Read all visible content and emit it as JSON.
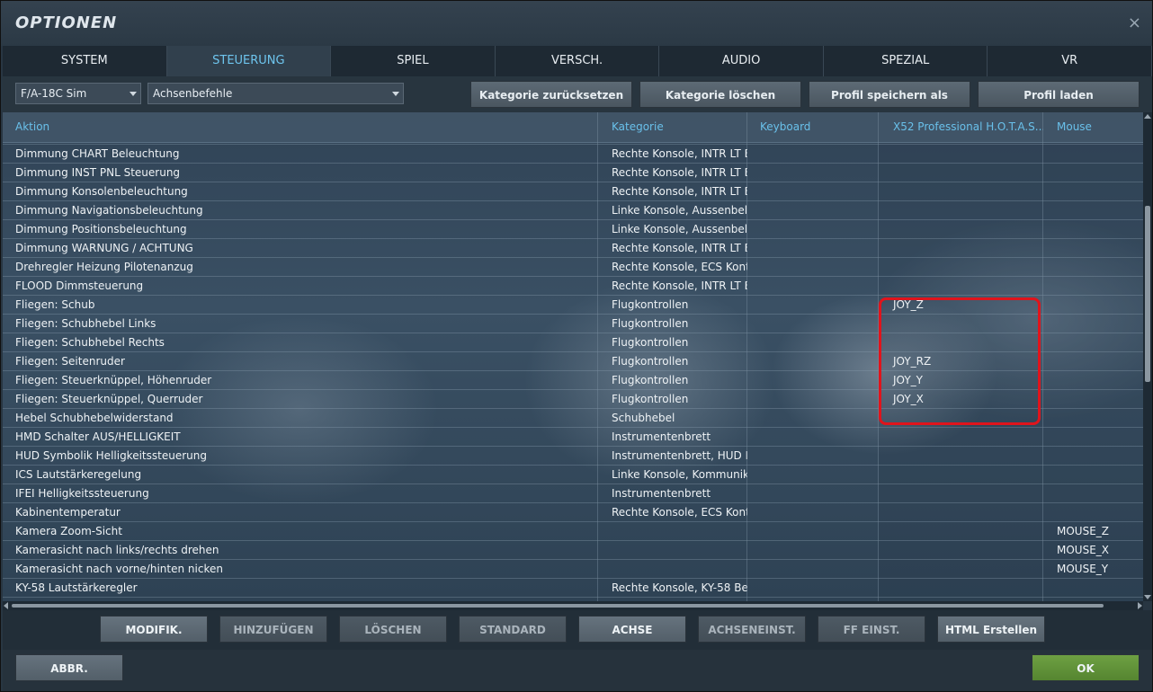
{
  "window": {
    "title": "OPTIONEN",
    "close_glyph": "×"
  },
  "tabs": [
    {
      "label": "SYSTEM",
      "active": false
    },
    {
      "label": "STEUERUNG",
      "active": true
    },
    {
      "label": "SPIEL",
      "active": false
    },
    {
      "label": "VERSCH.",
      "active": false
    },
    {
      "label": "AUDIO",
      "active": false
    },
    {
      "label": "SPEZIAL",
      "active": false
    },
    {
      "label": "VR",
      "active": false
    }
  ],
  "toolbar": {
    "aircraft_select": "F/A-18C Sim",
    "category_select": "Achsenbefehle",
    "buttons": [
      "Kategorie zurücksetzen",
      "Kategorie löschen",
      "Profil speichern als",
      "Profil laden"
    ]
  },
  "table": {
    "columns": [
      "Aktion",
      "Kategorie",
      "Keyboard",
      "X52 Professional H.O.T.A.S...",
      "Mouse"
    ],
    "rows": [
      [
        "Dimmung CHART Beleuchtung",
        "Rechte Konsole, INTR LT E",
        "",
        "",
        ""
      ],
      [
        "Dimmung INST PNL Steuerung",
        "Rechte Konsole, INTR LT E",
        "",
        "",
        ""
      ],
      [
        "Dimmung Konsolenbeleuchtung",
        "Rechte Konsole, INTR LT E",
        "",
        "",
        ""
      ],
      [
        "Dimmung Navigationsbeleuchtung",
        "Linke Konsole, Aussenbele",
        "",
        "",
        ""
      ],
      [
        "Dimmung Positionsbeleuchtung",
        "Linke Konsole, Aussenbele",
        "",
        "",
        ""
      ],
      [
        "Dimmung WARNUNG / ACHTUNG",
        "Rechte Konsole, INTR LT E",
        "",
        "",
        ""
      ],
      [
        "Drehregler Heizung Pilotenanzug",
        "Rechte Konsole, ECS Kont",
        "",
        "",
        ""
      ],
      [
        "FLOOD Dimmsteuerung",
        "Rechte Konsole, INTR LT E",
        "",
        "",
        ""
      ],
      [
        "Fliegen: Schub",
        "Flugkontrollen",
        "",
        "JOY_Z",
        ""
      ],
      [
        "Fliegen: Schubhebel Links",
        "Flugkontrollen",
        "",
        "",
        ""
      ],
      [
        "Fliegen: Schubhebel Rechts",
        "Flugkontrollen",
        "",
        "",
        ""
      ],
      [
        "Fliegen: Seitenruder",
        "Flugkontrollen",
        "",
        "JOY_RZ",
        ""
      ],
      [
        "Fliegen: Steuerknüppel, Höhenruder",
        "Flugkontrollen",
        "",
        "JOY_Y",
        ""
      ],
      [
        "Fliegen: Steuerknüppel, Querruder",
        "Flugkontrollen",
        "",
        "JOY_X",
        ""
      ],
      [
        "Hebel Schubhebelwiderstand",
        "Schubhebel",
        "",
        "",
        ""
      ],
      [
        "HMD Schalter AUS/HELLIGKEIT",
        "Instrumentenbrett",
        "",
        "",
        ""
      ],
      [
        "HUD Symbolik Helligkeitssteuerung",
        "Instrumentenbrett, HUD E",
        "",
        "",
        ""
      ],
      [
        "ICS Lautstärkeregelung",
        "Linke Konsole, Kommunik",
        "",
        "",
        ""
      ],
      [
        "IFEI Helligkeitssteuerung",
        "Instrumentenbrett",
        "",
        "",
        ""
      ],
      [
        "Kabinentemperatur",
        "Rechte Konsole, ECS Kont",
        "",
        "",
        ""
      ],
      [
        "Kamera Zoom-Sicht",
        "",
        "",
        "",
        "MOUSE_Z"
      ],
      [
        "Kamerasicht nach links/rechts drehen",
        "",
        "",
        "",
        "MOUSE_X"
      ],
      [
        "Kamerasicht nach vorne/hinten nicken",
        "",
        "",
        "",
        "MOUSE_Y"
      ],
      [
        "KY-58 Lautstärkeregler",
        "Rechte Konsole, KY-58 Be",
        "",
        "",
        ""
      ]
    ]
  },
  "action_buttons": [
    {
      "label": "MODIFIK.",
      "enabled": true
    },
    {
      "label": "HINZUFÜGEN",
      "enabled": false
    },
    {
      "label": "LÖSCHEN",
      "enabled": false
    },
    {
      "label": "STANDARD",
      "enabled": false
    },
    {
      "label": "ACHSE",
      "enabled": true
    },
    {
      "label": "ACHSENEINST.",
      "enabled": false
    },
    {
      "label": "FF EINST.",
      "enabled": false
    },
    {
      "label": "HTML Erstellen",
      "enabled": true
    }
  ],
  "footer": {
    "cancel_label": "ABBR.",
    "ok_label": "OK"
  },
  "colors": {
    "accent_text": "#69c0ea",
    "ok_button": "#6ea043",
    "highlight_box": "#e0141c"
  }
}
